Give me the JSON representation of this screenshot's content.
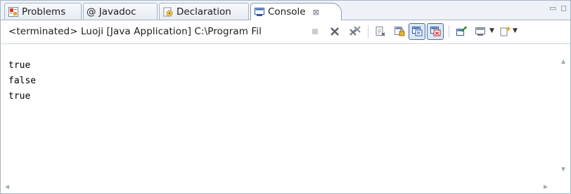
{
  "tabs": [
    {
      "label": "Problems",
      "icon": "problems-icon"
    },
    {
      "label": "@ Javadoc",
      "icon": "at-icon"
    },
    {
      "label": "Declaration",
      "icon": "declaration-icon"
    },
    {
      "label": "Console",
      "icon": "console-icon",
      "active": true,
      "close": "⊠"
    }
  ],
  "toolbar": {
    "status": "<terminated> Luoji [Java Application] C:\\Program Fil",
    "buttons": [
      "terminate",
      "remove-launch",
      "remove-all-terminated",
      "clear-console",
      "scroll-lock",
      "show-console-on-stdout",
      "show-console-on-stderr",
      "pin-console",
      "display-selected-console",
      "open-console"
    ]
  },
  "console": {
    "lines": [
      "true",
      "false",
      "true"
    ]
  }
}
